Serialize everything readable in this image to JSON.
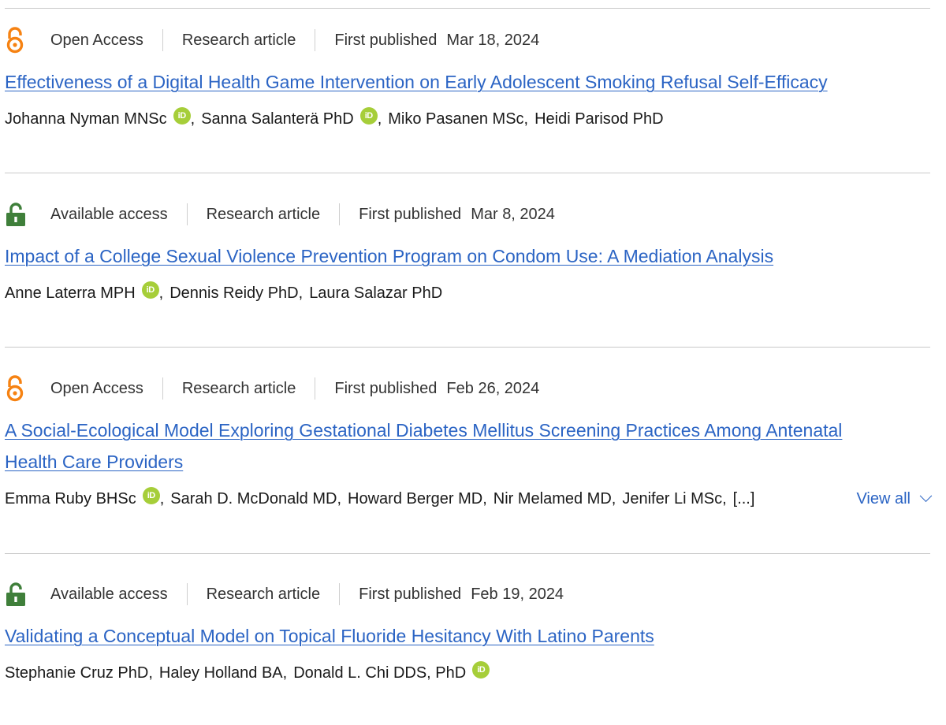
{
  "articles": [
    {
      "access_type": "open",
      "access_label": "Open Access",
      "article_type": "Research article",
      "published_label": "First published",
      "published_date": "Mar 18, 2024",
      "title": "Effectiveness of a Digital Health Game Intervention on Early Adolescent Smoking Refusal Self-Efficacy",
      "authors": [
        {
          "name": "Johanna Nyman MNSc",
          "orcid": true
        },
        {
          "name": "Sanna Salanterä PhD",
          "orcid": true
        },
        {
          "name": "Miko Pasanen MSc",
          "orcid": false
        },
        {
          "name": "Heidi Parisod PhD",
          "orcid": false
        }
      ]
    },
    {
      "access_type": "available",
      "access_label": "Available access",
      "article_type": "Research article",
      "published_label": "First published",
      "published_date": "Mar 8, 2024",
      "title": "Impact of a College Sexual Violence Prevention Program on Condom Use: A Mediation Analysis",
      "authors": [
        {
          "name": "Anne Laterra MPH",
          "orcid": true
        },
        {
          "name": "Dennis Reidy PhD",
          "orcid": false
        },
        {
          "name": "Laura Salazar PhD",
          "orcid": false
        }
      ]
    },
    {
      "access_type": "open",
      "access_label": "Open Access",
      "article_type": "Research article",
      "published_label": "First published",
      "published_date": "Feb 26, 2024",
      "title": "A Social-Ecological Model Exploring Gestational Diabetes Mellitus Screening Practices Among Antenatal Health Care Providers",
      "authors": [
        {
          "name": "Emma Ruby BHSc",
          "orcid": true
        },
        {
          "name": "Sarah D. McDonald MD",
          "orcid": false
        },
        {
          "name": "Howard Berger MD",
          "orcid": false
        },
        {
          "name": "Nir Melamed MD",
          "orcid": false
        },
        {
          "name": "Jenifer Li MSc",
          "orcid": false
        }
      ],
      "more_authors": "[...]",
      "view_all_label": "View all"
    },
    {
      "access_type": "available",
      "access_label": "Available access",
      "article_type": "Research article",
      "published_label": "First published",
      "published_date": "Feb 19, 2024",
      "title": "Validating a Conceptual Model on Topical Fluoride Hesitancy With Latino Parents",
      "authors": [
        {
          "name": "Stephanie Cruz PhD",
          "orcid": false
        },
        {
          "name": "Haley Holland BA",
          "orcid": false
        },
        {
          "name": "Donald L. Chi DDS, PhD",
          "orcid": true
        }
      ]
    }
  ],
  "orcid_glyph": "iD",
  "colors": {
    "link": "#2b64c4",
    "open_access_icon": "#f68212",
    "available_access_icon": "#3f7f3a",
    "orcid": "#a6ce39",
    "divider": "#c9c9c9"
  }
}
